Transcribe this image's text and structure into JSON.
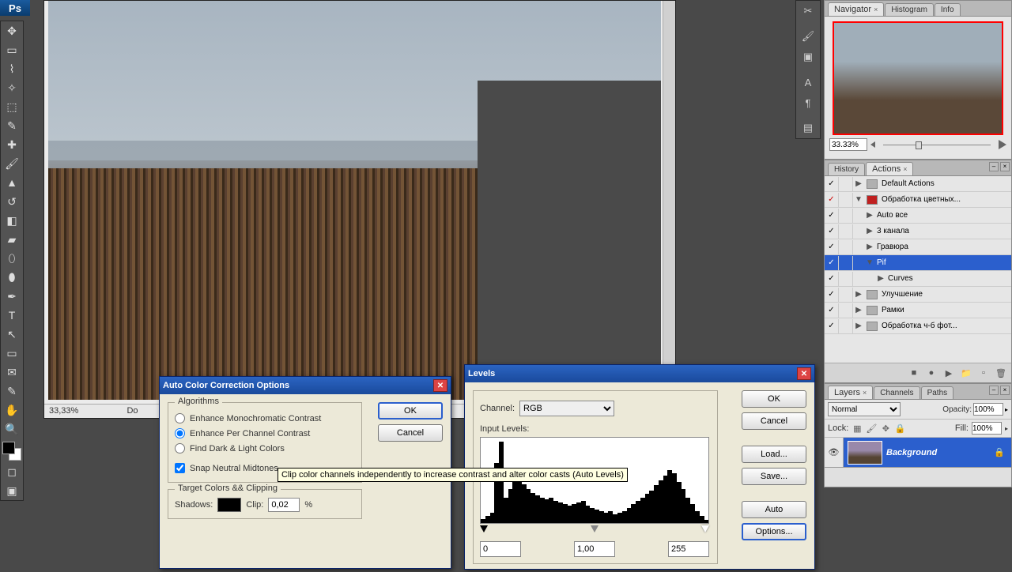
{
  "app": {
    "short": "Ps"
  },
  "document": {
    "zoom": "33,33%",
    "status_prefix": "Do"
  },
  "navigator": {
    "tabs": [
      "Navigator",
      "Histogram",
      "Info"
    ],
    "zoom": "33.33%"
  },
  "actions_panel": {
    "tabs": [
      "History",
      "Actions"
    ],
    "active_tab": 1,
    "rows": [
      {
        "check": "✓",
        "toggle": "▶",
        "folder": true,
        "label": "Default Actions",
        "depth": 0
      },
      {
        "check": "✓",
        "redcheck": true,
        "toggle": "▼",
        "folder": true,
        "redfolder": true,
        "label": "Обработка цветных...",
        "depth": 0
      },
      {
        "check": "✓",
        "toggle": "▶",
        "label": "Auto все",
        "depth": 1
      },
      {
        "check": "✓",
        "toggle": "▶",
        "label": "3 канала",
        "depth": 1
      },
      {
        "check": "✓",
        "toggle": "▶",
        "label": "Гравюра",
        "depth": 1
      },
      {
        "check": "✓",
        "toggle": "▼",
        "label": "Pif",
        "depth": 1,
        "selected": true
      },
      {
        "check": "✓",
        "toggle": "▶",
        "label": "Curves",
        "depth": 2
      },
      {
        "check": "✓",
        "toggle": "▶",
        "folder": true,
        "label": "Улучшение",
        "depth": 0
      },
      {
        "check": "✓",
        "toggle": "▶",
        "folder": true,
        "label": "Рамки",
        "depth": 0
      },
      {
        "check": "✓",
        "toggle": "▶",
        "folder": true,
        "label": "Обработка ч-б фот...",
        "depth": 0
      }
    ]
  },
  "layers_panel": {
    "tabs": [
      "Layers",
      "Channels",
      "Paths"
    ],
    "blend_mode": "Normal",
    "opacity_label": "Opacity:",
    "opacity": "100%",
    "lock_label": "Lock:",
    "fill_label": "Fill:",
    "fill": "100%",
    "layer_name": "Background"
  },
  "auto_color_dialog": {
    "title": "Auto Color Correction Options",
    "group_algorithms": "Algorithms",
    "radio1": "Enhance Monochromatic Contrast",
    "radio2": "Enhance Per Channel Contrast",
    "radio3": "Find Dark & Light Colors",
    "chk_snap": "Snap Neutral Midtones",
    "group_target": "Target Colors && Clipping",
    "shadows_label": "Shadows:",
    "clip_label": "Clip:",
    "clip_value": "0,02",
    "pct": "%",
    "ok": "OK",
    "cancel": "Cancel",
    "tooltip": "Clip color channels independently to increase contrast and alter color casts (Auto Levels)"
  },
  "levels_dialog": {
    "title": "Levels",
    "channel_label": "Channel:",
    "channel": "RGB",
    "input_label": "Input Levels:",
    "in_black": "0",
    "in_mid": "1,00",
    "in_white": "255",
    "ok": "OK",
    "cancel": "Cancel",
    "load": "Load...",
    "save": "Save...",
    "auto": "Auto",
    "options": "Options..."
  }
}
